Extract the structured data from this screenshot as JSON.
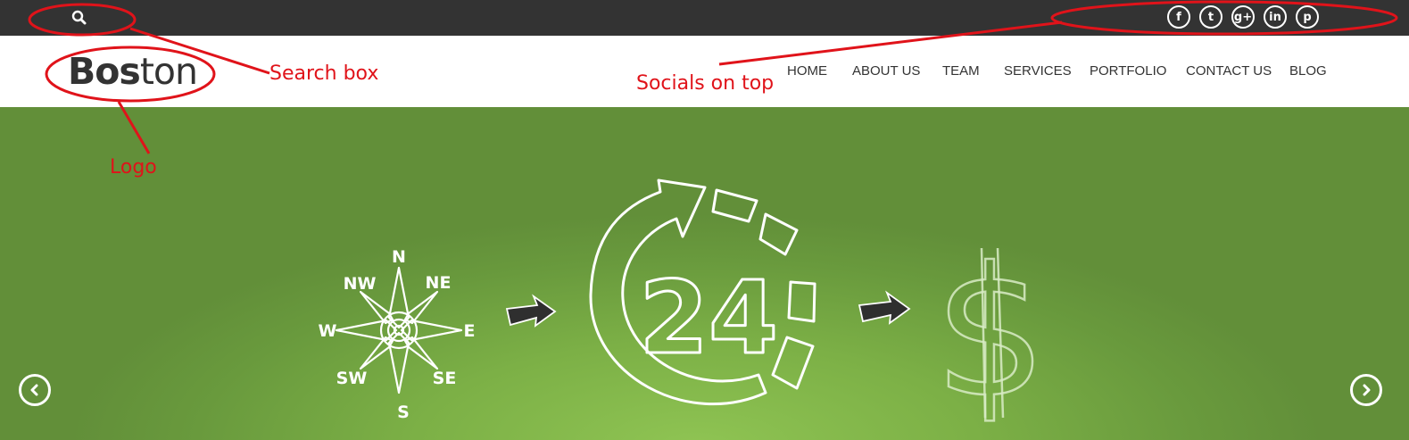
{
  "logo": {
    "bold": "Bos",
    "regular": "ton"
  },
  "socials": [
    {
      "glyph": "f",
      "icon": "facebook-icon"
    },
    {
      "glyph": "t",
      "icon": "twitter-icon"
    },
    {
      "glyph": "g+",
      "icon": "google-plus-icon"
    },
    {
      "glyph": "in",
      "icon": "linkedin-icon"
    },
    {
      "glyph": "p",
      "icon": "pinterest-icon"
    }
  ],
  "nav": [
    "HOME",
    "ABOUT US",
    "TEAM",
    "SERVICES",
    "PORTFOLIO",
    "CONTACT US",
    "BLOG"
  ],
  "hero": {
    "compass": [
      "N",
      "NE",
      "E",
      "SE",
      "S",
      "SW",
      "W",
      "NW"
    ],
    "clock_number": "24",
    "currency": "$"
  },
  "annotations": {
    "search": "Search box",
    "socials": "Socials on top",
    "logo": "Logo"
  },
  "colors": {
    "topbar": "#333333",
    "hero_green": "#7cb046",
    "annotation_red": "#e0131a"
  }
}
